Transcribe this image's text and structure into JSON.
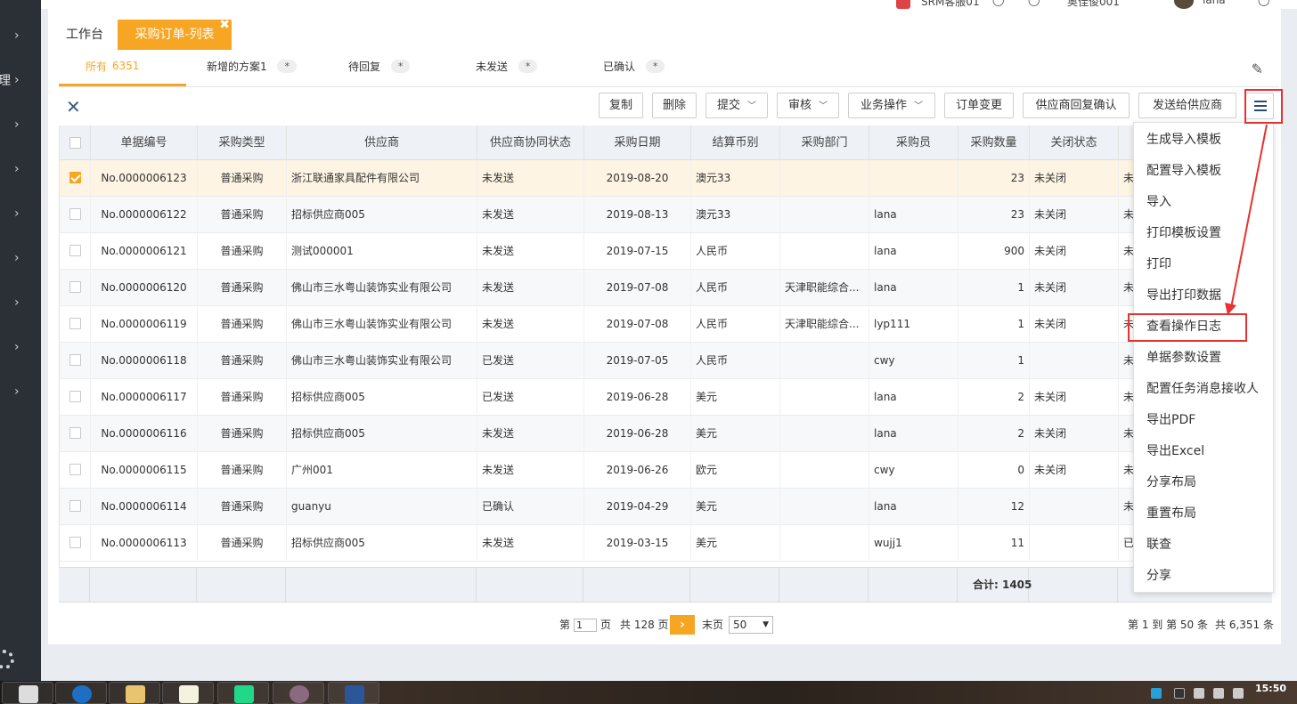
{
  "topbar": {
    "user_tag": "SRM客服01",
    "company": "奥佳俊001",
    "user": "lana"
  },
  "sidebar": {
    "cut_char": "理"
  },
  "page_tabs": {
    "home": "工作台",
    "active": "采购订单-列表",
    "close_glyph": "✖"
  },
  "sub_tabs": [
    {
      "label": "所有",
      "count": "6351"
    },
    {
      "label": "新增的方案1",
      "count": "*"
    },
    {
      "label": "待回复",
      "count": "*"
    },
    {
      "label": "未发送",
      "count": "*"
    },
    {
      "label": "已确认",
      "count": "*"
    }
  ],
  "toolbar": {
    "copy": "复制",
    "delete": "删除",
    "submit": "提交",
    "audit": "审核",
    "business": "业务操作",
    "order_change": "订单变更",
    "supplier_confirm": "供应商回复确认",
    "send_supplier": "发送给供应商",
    "chevron": "﹀"
  },
  "table": {
    "columns": [
      "单据编号",
      "采购类型",
      "供应商",
      "供应商协同状态",
      "采购日期",
      "结算币别",
      "采购部门",
      "采购员",
      "采购数量",
      "关闭状态",
      ""
    ],
    "rows": [
      [
        "No.0000006123",
        "普通采购",
        "浙江联通家具配件有限公司",
        "未发送",
        "2019-08-20",
        "澳元33",
        "",
        "",
        "23",
        "未关闭",
        "未"
      ],
      [
        "No.0000006122",
        "普通采购",
        "招标供应商005",
        "未发送",
        "2019-08-13",
        "澳元33",
        "",
        "lana",
        "23",
        "未关闭",
        "未"
      ],
      [
        "No.0000006121",
        "普通采购",
        "测试000001",
        "未发送",
        "2019-07-15",
        "人民币",
        "",
        "lana",
        "900",
        "未关闭",
        "未"
      ],
      [
        "No.0000006120",
        "普通采购",
        "佛山市三水粤山装饰实业有限公司",
        "未发送",
        "2019-07-08",
        "人民币",
        "天津职能综合...",
        "lana",
        "1",
        "未关闭",
        "未"
      ],
      [
        "No.0000006119",
        "普通采购",
        "佛山市三水粤山装饰实业有限公司",
        "未发送",
        "2019-07-08",
        "人民币",
        "天津职能综合...",
        "lyp111",
        "1",
        "未关闭",
        "未"
      ],
      [
        "No.0000006118",
        "普通采购",
        "佛山市三水粤山装饰实业有限公司",
        "已发送",
        "2019-07-05",
        "人民币",
        "",
        "cwy",
        "1",
        "",
        "未"
      ],
      [
        "No.0000006117",
        "普通采购",
        "招标供应商005",
        "已发送",
        "2019-06-28",
        "美元",
        "",
        "lana",
        "2",
        "未关闭",
        "未"
      ],
      [
        "No.0000006116",
        "普通采购",
        "招标供应商005",
        "未发送",
        "2019-06-28",
        "美元",
        "",
        "lana",
        "2",
        "未关闭",
        "未"
      ],
      [
        "No.0000006115",
        "普通采购",
        "广州001",
        "未发送",
        "2019-06-26",
        "欧元",
        "",
        "cwy",
        "0",
        "未关闭",
        "未"
      ],
      [
        "No.0000006114",
        "普通采购",
        "guanyu",
        "已确认",
        "2019-04-29",
        "美元",
        "",
        "lana",
        "12",
        "",
        "未"
      ],
      [
        "No.0000006113",
        "普通采购",
        "招标供应商005",
        "未发送",
        "2019-03-15",
        "美元",
        "",
        "wujj1",
        "11",
        "",
        "已"
      ]
    ],
    "selected_row": 0,
    "total_label": "合计: 1405"
  },
  "pager": {
    "page_prefix": "第",
    "page_value": "1",
    "page_suffix": "页",
    "total_pages": "共 128 页",
    "next_glyph": "›",
    "last": "末页",
    "page_size": "50",
    "range": "第 1 到 第 50 条",
    "total": "共 6,351 条"
  },
  "menu": {
    "items": [
      "生成导入模板",
      "配置导入模板",
      "导入",
      "打印模板设置",
      "打印",
      "导出打印数据",
      "查看操作日志",
      "单据参数设置",
      "配置任务消息接收人",
      "导出PDF",
      "导出Excel",
      "分享布局",
      "重置布局",
      "联查",
      "分享"
    ],
    "highlighted": "查看操作日志"
  },
  "taskbar": {
    "clock": "15:50"
  },
  "colors": {
    "accent": "#f6a623",
    "highlight_red": "#e8322f",
    "sidebar": "#2b3036",
    "icon_blue": "#2c4a74"
  },
  "icons": {
    "close": "close-icon",
    "menu": "hamburger-menu-icon",
    "edit": "pencil-icon",
    "settings": "gear-icon"
  }
}
